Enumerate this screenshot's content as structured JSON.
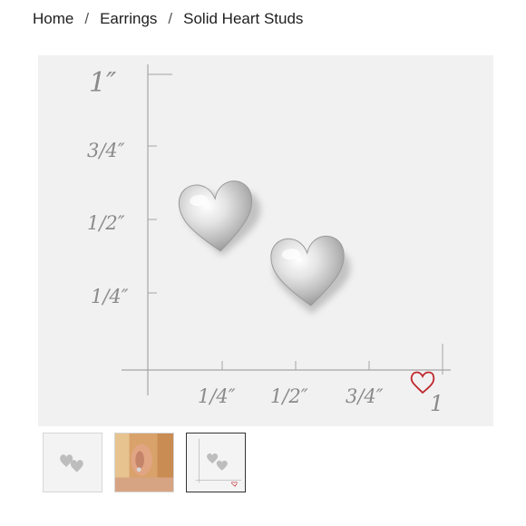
{
  "breadcrumb": {
    "items": [
      {
        "label": "Home"
      },
      {
        "label": "Earrings"
      }
    ],
    "separator": "/",
    "current": "Solid Heart Studs"
  },
  "product_image": {
    "ruler": {
      "y_labels": [
        "1″",
        "3/4″",
        "1/2″",
        "1/4″"
      ],
      "x_labels": [
        "1/4″",
        "1/2″",
        "3/4″",
        "1"
      ]
    },
    "logo_icon": "heart-outline-icon",
    "accent_color": "#c0282d",
    "background_color": "#f1f1f1"
  },
  "thumbnails": [
    {
      "name": "heart studs close-up"
    },
    {
      "name": "model wearing earring"
    },
    {
      "name": "heart studs with ruler",
      "active": true
    }
  ]
}
